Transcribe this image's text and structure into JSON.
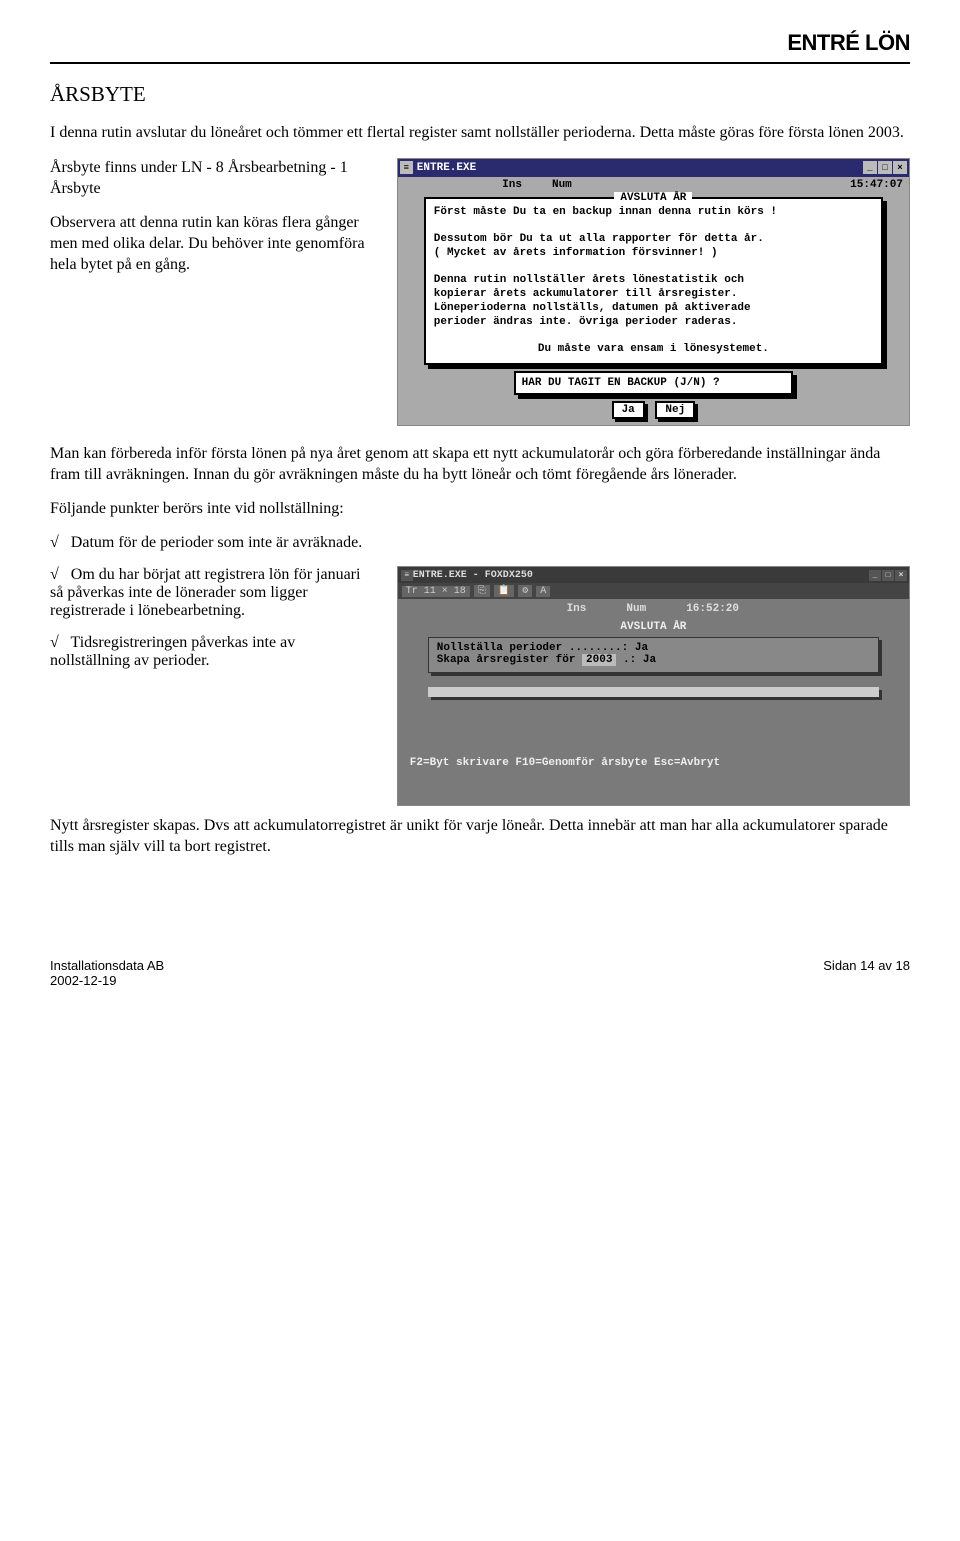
{
  "header": {
    "brand": "ENTRÉ LÖN"
  },
  "title": "ÅRSBYTE",
  "intro": "I denna rutin avslutar du löneåret och tömmer ett flertal register samt nollställer perioderna. Detta måste göras före första lönen 2003.",
  "left1a": "Årsbyte finns under LN - 8 Årsbearbetning - 1 Årsbyte",
  "left1b": "Observera att denna rutin kan köras flera gånger men med olika delar. Du behöver inte genomföra hela bytet på en gång.",
  "doswin1": {
    "wintitle": "ENTRE.EXE",
    "status": {
      "ins": "Ins",
      "num": "Num",
      "time": "15:47:07"
    },
    "panel_title": "AVSLUTA ÅR",
    "l1": "Först måste Du ta en backup innan denna rutin körs !",
    "l2": "Dessutom bör Du ta ut alla rapporter för detta år.",
    "l3": "( Mycket av årets information försvinner! )",
    "l4": "Denna rutin nollställer årets lönestatistik och",
    "l5": "kopierar årets ackumulatorer till årsregister.",
    "l6": "Löneperioderna nollställs, datumen på aktiverade",
    "l7": "perioder ändras inte. övriga perioder raderas.",
    "l8": "Du måste vara ensam i lönesystemet.",
    "prompt": "HAR DU TAGIT EN BACKUP (J/N) ?",
    "btn_yes": "Ja",
    "btn_no": "Nej"
  },
  "para2": "Man kan förbereda inför första lönen på nya året genom att skapa ett nytt ackumulatorår och göra förberedande inställningar ända fram till avräkningen. Innan du gör avräkningen måste du ha bytt löneår och tömt föregående års lönerader.",
  "para3_intro": "Följande punkter berörs inte vid nollställning:",
  "bullet1": "Datum för de perioder som inte är avräknade.",
  "left2a": "Om du har börjat att registrera lön för januari så påverkas inte de lönerader som ligger registrerade i lönebearbetning.",
  "left2b": "Tidsregistreringen påverkas inte av nollställning av perioder.",
  "doswin2": {
    "wintitle": "ENTRE.EXE - FOXDX250",
    "toolbar": {
      "font": "Tr 11 × 18",
      "a": "A"
    },
    "status": {
      "ins": "Ins",
      "num": "Num",
      "time": "16:52:20"
    },
    "dlg_title": "AVSLUTA ÅR",
    "row1_label": "Nollställa perioder ........:",
    "row1_val": "Ja",
    "row2_label": "Skapa årsregister för",
    "row2_val": "2003",
    "row2_after": ".: Ja",
    "footer_keys": "F2=Byt skrivare   F10=Genomför årsbyte   Esc=Avbryt"
  },
  "para4": "Nytt årsregister skapas. Dvs att ackumulatorregistret är unikt för varje löneår. Detta innebär att man har alla ackumulatorer sparade tills man själv vill ta bort registret.",
  "footer": {
    "left1": "Installationsdata AB",
    "left2": "2002-12-19",
    "right": "Sidan 14 av 18"
  }
}
